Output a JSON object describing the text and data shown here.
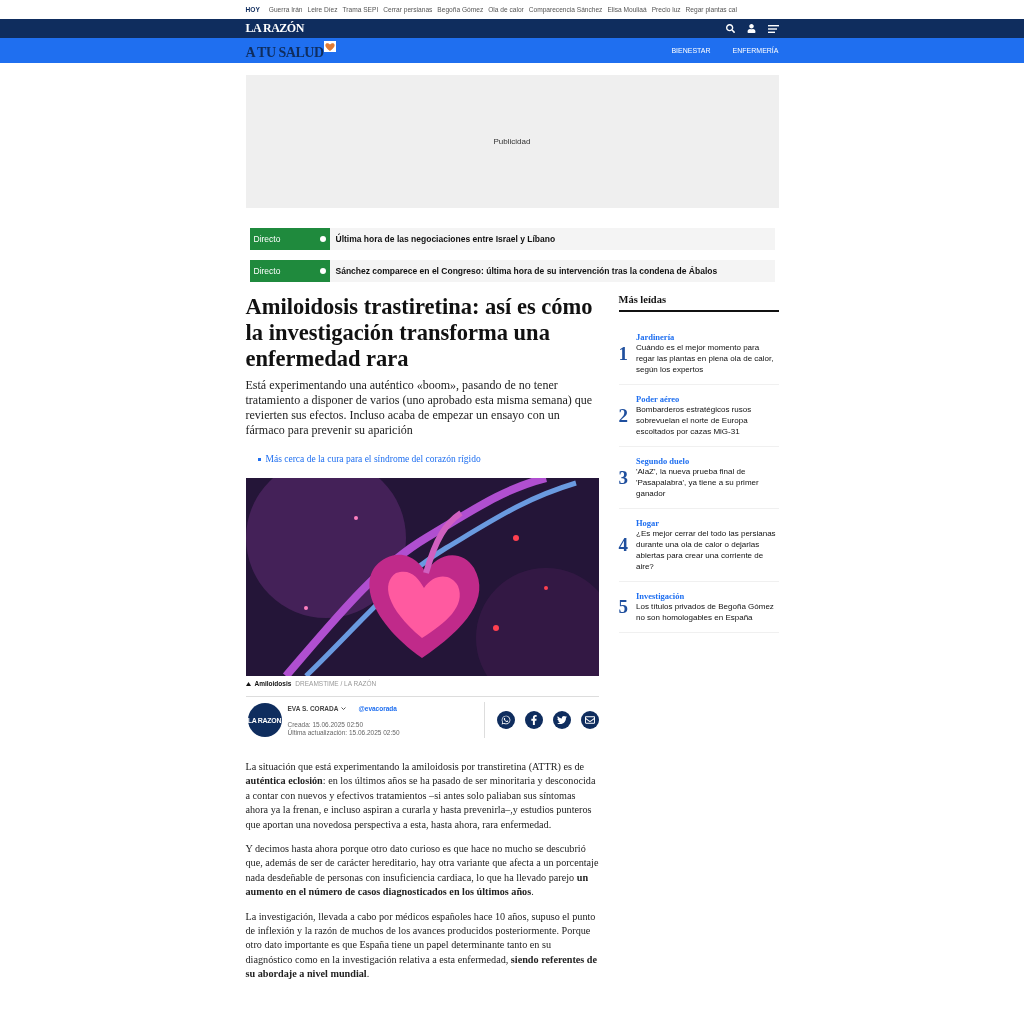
{
  "topics": {
    "label": "HOY",
    "items": [
      "Guerra Irán",
      "Leire Díez",
      "Trama SEPI",
      "Cerrar persianas",
      "Begoña Gómez",
      "Ola de calor",
      "Comparecencia Sánchez",
      "Elisa Mouliaá",
      "Precio luz",
      "Regar plantas cal"
    ]
  },
  "header": {
    "logo": "LA RAZÓN"
  },
  "section_bar": {
    "logo": "A TU SALUD",
    "links": [
      "BIENESTAR",
      "ENFERMERÍA"
    ]
  },
  "ad": {
    "label": "Publicidad"
  },
  "live": [
    {
      "badge": "Directo",
      "title": "Última hora de las negociaciones entre Israel y Líbano"
    },
    {
      "badge": "Directo",
      "title": "Sánchez comparece en el Congreso: última hora de su intervención tras la condena de Ábalos"
    }
  ],
  "article": {
    "title": "Amiloidosis trastiretina: así es cómo la investigación transforma una enfermedad rara",
    "subtitle": "Está experimentando una auténtico «boom», pasando de no tener tratamiento a disponer de varios (uno aprobado esta misma semana) que revierten sus efectos. Incluso acaba de empezar un ensayo con un fármaco para prevenir su aparición",
    "related": [
      "Más cerca de la cura para el síndrome del corazón rígido"
    ],
    "image": {
      "caption": "Amiloidosis",
      "credit": "DREAMSTIME / LA RAZÓN"
    },
    "author": {
      "avatar": "LA RAZON",
      "name": "EVA S. CORADA",
      "handle": "@evacorada",
      "created": "Creada: 15.06.2025 02:50",
      "updated": "Última actualización: 15.06.2025 02:50"
    },
    "share": [
      {
        "kind": "whatsapp"
      },
      {
        "kind": "facebook"
      },
      {
        "kind": "twitter"
      },
      {
        "kind": "email"
      }
    ],
    "body": [
      "La situación que está experimentando la amiloidosis por transtiretina (ATTR) es de **auténtica eclosión**: en los últimos años se ha pasado de ser minoritaria y desconocida a contar con nuevos y efectivos tratamientos –si antes solo paliaban sus síntomas ahora ya la frenan, e incluso aspiran a curarla y hasta prevenirla–,y estudios punteros que aportan una novedosa perspectiva a esta, hasta ahora, rara enfermedad.",
      "Y decimos hasta ahora porque otro dato curioso es que hace no mucho se descubrió que, además de ser de carácter hereditario, hay otra variante que afecta a un porcentaje nada desdeñable de personas con insuficiencia cardiaca, lo que ha llevado parejo **un aumento en el número de casos diagnosticados en los últimos años**.",
      "La investigación, llevada a cabo por médicos españoles hace 10 años, supuso el punto de inflexión y la razón de muchos de los avances producidos posteriormente. Porque otro dato importante es que España tiene un papel determinante tanto en su diagnóstico como en la investigación relativa a esta enfermedad, **siendo referentes de su abordaje a nivel mundial**."
    ]
  },
  "most_read": {
    "title": "Más leídas",
    "items": [
      {
        "number": "1",
        "category": "Jardinería",
        "title": "Cuándo es el mejor momento para regar las plantas en plena ola de calor, según los expertos"
      },
      {
        "number": "2",
        "category": "Poder aéreo",
        "title": "Bombarderos estratégicos rusos sobrevuelan el norte de Europa escoltados por cazas MiG-31"
      },
      {
        "number": "3",
        "category": "Segundo duelo",
        "title": "'AlaZ', la nueva prueba final de 'Pasapalabra', ya tiene a su primer ganador"
      },
      {
        "number": "4",
        "category": "Hogar",
        "title": "¿Es mejor cerrar del todo las persianas durante una ola de calor o dejarlas abiertas para crear una corriente de aire?"
      },
      {
        "number": "5",
        "category": "Investigación",
        "title": "Los títulos privados de Begoña Gómez no son homologables en España"
      }
    ]
  }
}
